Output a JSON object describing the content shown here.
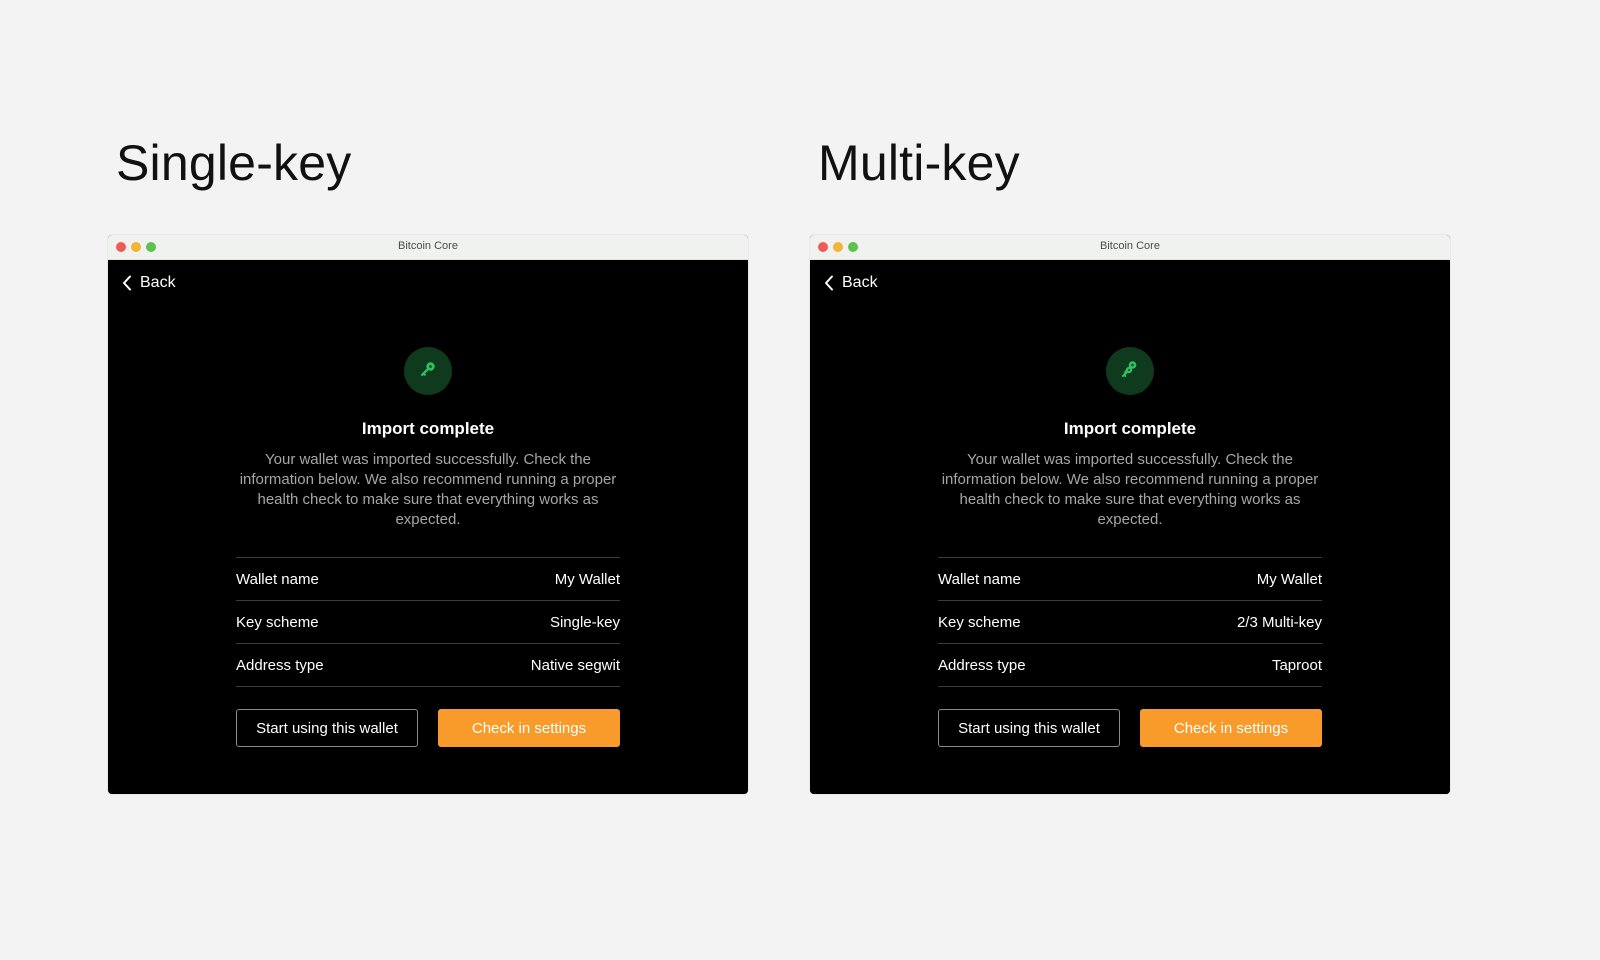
{
  "headings": {
    "left": "Single-key",
    "right": "Multi-key"
  },
  "windows": [
    {
      "window_title": "Bitcoin Core",
      "back_label": "Back",
      "icon": "key-icon",
      "title": "Import complete",
      "description": "Your wallet was imported successfully. Check the information below. We also recommend running a proper health check to make sure that everything works as expected.",
      "rows": [
        {
          "label": "Wallet name",
          "value": "My Wallet"
        },
        {
          "label": "Key scheme",
          "value": "Single-key"
        },
        {
          "label": "Address type",
          "value": "Native segwit"
        }
      ],
      "secondary_button": "Start using this wallet",
      "primary_button": "Check in settings"
    },
    {
      "window_title": "Bitcoin Core",
      "back_label": "Back",
      "icon": "multi-key-icon",
      "title": "Import complete",
      "description": "Your wallet was imported successfully. Check the information below. We also recommend running a proper health check to make sure that everything works as expected.",
      "rows": [
        {
          "label": "Wallet name",
          "value": "My Wallet"
        },
        {
          "label": "Key scheme",
          "value": "2/3 Multi-key"
        },
        {
          "label": "Address type",
          "value": "Taproot"
        }
      ],
      "secondary_button": "Start using this wallet",
      "primary_button": "Check in settings"
    }
  ],
  "colors": {
    "accent": "#f89b2a",
    "icon_green": "#2fbf5f",
    "icon_badge_bg": "#0f3a1e",
    "window_bg": "#000000",
    "page_bg": "#f3f3f3"
  }
}
